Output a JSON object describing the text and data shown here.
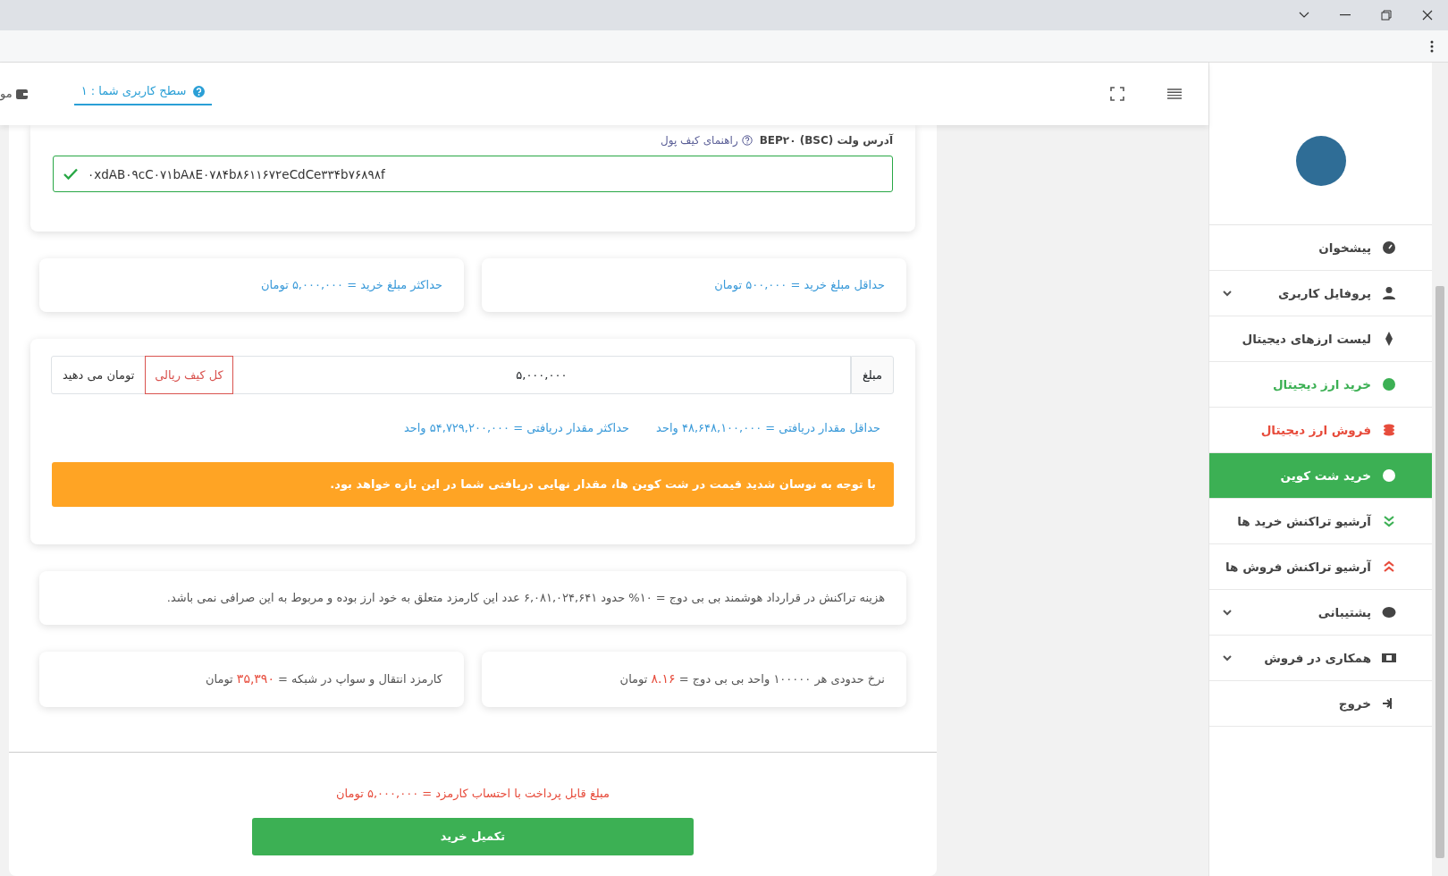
{
  "header": {
    "cut_text": "مو",
    "level_label": "سطح کاربری شما :",
    "level_value": "۱"
  },
  "sidebar": {
    "items": [
      {
        "label": "پیشخوان",
        "selected": false,
        "expandable": false,
        "color": "#444444"
      },
      {
        "label": "پروفایل کاربری",
        "selected": false,
        "expandable": true,
        "color": "#444444"
      },
      {
        "label": "لیست ارزهای دیجیتال",
        "selected": false,
        "expandable": false,
        "color": "#444444"
      },
      {
        "label": "خرید ارز دیجیتال",
        "selected": false,
        "expandable": false,
        "color": "#3cb054"
      },
      {
        "label": "فروش ارز دیجیتال",
        "selected": false,
        "expandable": false,
        "color": "#e74c3c"
      },
      {
        "label": "خرید شت کوین",
        "selected": true,
        "expandable": false
      },
      {
        "label": "آرشیو تراکنش خرید ها",
        "selected": false,
        "expandable": false,
        "color": "#444444"
      },
      {
        "label": "آرشیو تراکنش فروش ها",
        "selected": false,
        "expandable": false,
        "color": "#444444"
      },
      {
        "label": "پشتیبانی",
        "selected": false,
        "expandable": true,
        "color": "#444444"
      },
      {
        "label": "همکاری در فروش",
        "selected": false,
        "expandable": true,
        "color": "#444444"
      },
      {
        "label": "خروج",
        "selected": false,
        "expandable": false,
        "color": "#444444"
      }
    ]
  },
  "wallet": {
    "label": "آدرس ولت BEP۲۰ (BSC)",
    "guide_link": "راهنمای کیف پول",
    "value": "۰xdAB۰۹cC۰۷۱bA۸E۰۷۸۴b۸۶۱۱۶۷۲eCdCe۳۳۴b۷۶۸۹۸f",
    "valid": true
  },
  "limits": [
    "حداقل مبلغ خرید = ۵۰۰,۰۰۰ تومان",
    "حداکثر مبلغ خرید = ۵,۰۰۰,۰۰۰ تومان"
  ],
  "amount": {
    "label": "مبلغ",
    "value": "۵,۰۰۰,۰۰۰",
    "all_button": "کل کیف ریالی",
    "suffix": "تومان می دهید"
  },
  "receive": [
    "حداقل مقدار دریافتی = ۴۸,۶۴۸,۱۰۰,۰۰۰ واحد",
    "حداکثر مقدار دریافتی = ۵۴,۷۲۹,۲۰۰,۰۰۰ واحد"
  ],
  "alert": "با توجه به نوسان شدید قیمت در شت کوین ها، مقدار نهایی دریافتی شما در این بازه خواهد بود.",
  "fee_note": "هزینه تراکنش در قرارداد هوشمند بی بی دوج = ۱۰% حدود ۶,۰۸۱,۰۲۴,۶۴۱ عدد این کارمزد متعلق به خود ارز بوده و مربوط به این صرافی نمی باشد.",
  "rates": [
    {
      "before": "نرخ حدودی هر ۱۰۰۰۰۰ واحد بی بی دوج = ",
      "value": "۸.۱۶",
      "after": " تومان"
    },
    {
      "before": "کارمزد انتقال و سواپ در شبکه = ",
      "value": "۳۵,۳۹۰",
      "after": " تومان"
    }
  ],
  "payable": "مبلغ قابل پرداخت با احتساب کارمزد = ۵,۰۰۰,۰۰۰ تومان",
  "submit": "تکمیل خرید"
}
